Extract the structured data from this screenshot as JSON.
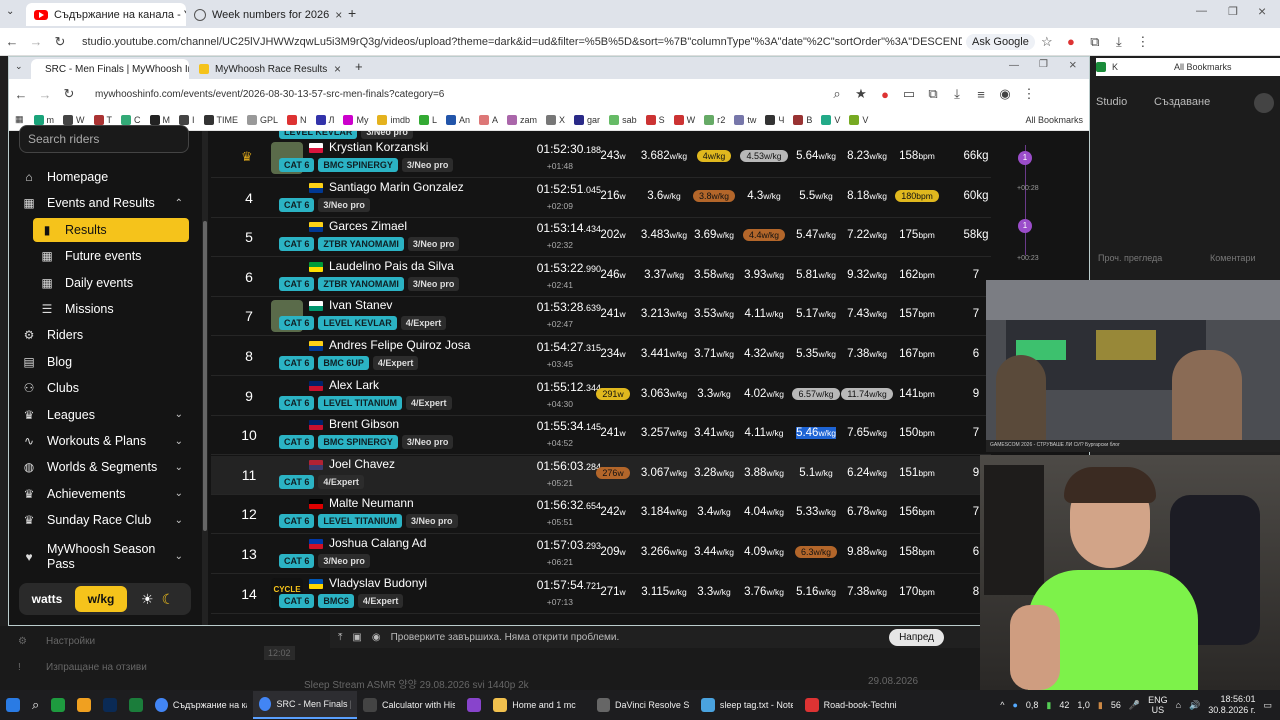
{
  "outer_browser": {
    "tabs": [
      {
        "title": "Съдържание на канала - YouT",
        "icon": "youtube-icon"
      },
      {
        "title": "Week numbers for 2026",
        "icon": "globe-icon"
      }
    ],
    "url": "studio.youtube.com/channel/UC25lVJHWWzqwLu5i3M9rQ3g/videos/upload?theme=dark&id=ud&filter=%5B%5D&sort=%7B\"columnType\"%3A\"date\"%2C\"sortOrder\"%3A\"DESCENDING\"%7D&udvid=hkzNmzPILNs",
    "ask_google": "Ask Google",
    "all_bookmarks": "All Bookmarks",
    "k_bookmark": "K"
  },
  "inner_browser": {
    "tabs": [
      {
        "title": "SRC - Men Finals | MyWhoosh In"
      },
      {
        "title": "MyWhoosh Race Results"
      }
    ],
    "url": "mywhooshinfo.com/events/event/2026-08-30-13-57-src-men-finals?category=6",
    "bookmarks": [
      "m",
      "W",
      "T",
      "C",
      "M",
      "I",
      "TIME",
      "GPL",
      "N",
      "Л",
      "My",
      "imdb",
      "L",
      "An",
      "A",
      "zam",
      "X",
      "gar",
      "sab",
      "S",
      "W",
      "г2",
      "tw",
      "Ч",
      "В",
      "V",
      "V"
    ],
    "all_bookmarks": "All Bookmarks"
  },
  "sidebar": {
    "search_placeholder": "Search riders",
    "items": [
      {
        "label": "Homepage",
        "icon": "home-icon"
      },
      {
        "label": "Events and Results",
        "icon": "calendar-icon",
        "expanded": true
      },
      {
        "label": "Results",
        "icon": "bar-chart-icon",
        "active": true,
        "sub": true
      },
      {
        "label": "Future events",
        "icon": "calendar-icon",
        "sub": true
      },
      {
        "label": "Daily events",
        "icon": "calendar-icon",
        "sub": true
      },
      {
        "label": "Missions",
        "icon": "list-icon",
        "sub": true
      },
      {
        "label": "Riders",
        "icon": "bike-icon"
      },
      {
        "label": "Blog",
        "icon": "doc-icon"
      },
      {
        "label": "Clubs",
        "icon": "users-icon"
      },
      {
        "label": "Leagues",
        "icon": "trophy-icon",
        "chev": true
      },
      {
        "label": "Workouts & Plans",
        "icon": "pulse-icon",
        "chev": true
      },
      {
        "label": "Worlds & Segments",
        "icon": "globe-icon",
        "chev": true
      },
      {
        "label": "Achievements",
        "icon": "trophy-icon",
        "chev": true
      },
      {
        "label": "Sunday Race Club",
        "icon": "trophy-icon",
        "chev": true
      },
      {
        "label": "MyWhoosh Season Pass",
        "icon": "heart-icon",
        "chev": true
      }
    ],
    "unit_watts": "watts",
    "unit_wkg": "w/kg"
  },
  "partial_top_tags": {
    "team": "LEVEL KEVLAR",
    "cls": "3/Neo pro"
  },
  "results": [
    {
      "pos": "3",
      "trophy": true,
      "name": "Krystian Korzanski",
      "flag": [
        "#fff",
        "#dc143c"
      ],
      "avatar": true,
      "cat": "CAT 6",
      "team": "BMC SPINERGY",
      "cls": "3/Neo pro",
      "time": "01:52:30",
      "ms": ".188",
      "gap": "+01:48",
      "watts": "243",
      "wkg": "3.682",
      "c1": "4",
      "c2": "4.53",
      "c3": "5.64",
      "c4": "8.23",
      "hr": "158",
      "wt": "66kg",
      "p1": "gold",
      "p2": "silver"
    },
    {
      "pos": "4",
      "name": "Santiago Marin Gonzalez",
      "flag": [
        "#fcd116",
        "#003893"
      ],
      "cat": "CAT 6",
      "cls": "3/Neo pro",
      "time": "01:52:51",
      "ms": ".045",
      "gap": "+02:09",
      "watts": "216",
      "wkg": "3.6",
      "c1": "3.8",
      "c2": "4.3",
      "c3": "5.5",
      "c4": "8.18",
      "hr": "180",
      "wt": "60kg",
      "p1": "bronze",
      "phr": "gold"
    },
    {
      "pos": "5",
      "name": "Garces Zimael",
      "flag": [
        "#fcd116",
        "#003893"
      ],
      "cat": "CAT 6",
      "team": "ZTBR YANOMAMI",
      "cls": "3/Neo pro",
      "time": "01:53:14",
      "ms": ".434",
      "gap": "+02:32",
      "watts": "202",
      "wkg": "3.483",
      "c1": "3.69",
      "c2": "4.4",
      "c3": "5.47",
      "c4": "7.22",
      "hr": "175",
      "wt": "58kg",
      "p2": "bronze"
    },
    {
      "pos": "6",
      "name": "Laudelino Pais da Silva",
      "flag": [
        "#009b3a",
        "#fedf00"
      ],
      "cat": "CAT 6",
      "team": "ZTBR YANOMAMI",
      "cls": "3/Neo pro",
      "time": "01:53:22",
      "ms": ".990",
      "gap": "+02:41",
      "watts": "246",
      "wkg": "3.37",
      "c1": "3.58",
      "c2": "3.93",
      "c3": "5.81",
      "c4": "9.32",
      "hr": "162",
      "wt": "7"
    },
    {
      "pos": "7",
      "name": "Ivan Stanev",
      "flag": [
        "#fff",
        "#00966e"
      ],
      "avatar": true,
      "cat": "CAT 6",
      "team": "LEVEL KEVLAR",
      "cls": "4/Expert",
      "time": "01:53:28",
      "ms": ".639",
      "gap": "+02:47",
      "watts": "241",
      "wkg": "3.213",
      "c1": "3.53",
      "c2": "4.11",
      "c3": "5.17",
      "c4": "7.43",
      "hr": "157",
      "wt": "7"
    },
    {
      "pos": "8",
      "name": "Andres Felipe Quiroz Josa",
      "flag": [
        "#fcd116",
        "#003893"
      ],
      "cat": "CAT 6",
      "team": "BMC 6UP",
      "cls": "4/Expert",
      "time": "01:54:27",
      "ms": ".315",
      "gap": "+03:45",
      "watts": "234",
      "wkg": "3.441",
      "c1": "3.71",
      "c2": "4.32",
      "c3": "5.35",
      "c4": "7.38",
      "hr": "167",
      "wt": "6"
    },
    {
      "pos": "9",
      "name": "Alex Lark",
      "flag": [
        "#012169",
        "#c8102e"
      ],
      "cat": "CAT 6",
      "team": "LEVEL TITANIUM",
      "cls": "4/Expert",
      "time": "01:55:12",
      "ms": ".344",
      "gap": "+04:30",
      "watts": "291",
      "wkg": "3.063",
      "c1": "3.3",
      "c2": "4.02",
      "c3": "6.57",
      "c4": "11.74",
      "hr": "141",
      "wt": "9",
      "pw": "gold",
      "p3": "silver",
      "p4": "silver"
    },
    {
      "pos": "10",
      "name": "Brent Gibson",
      "flag": [
        "#012169",
        "#c8102e"
      ],
      "cat": "CAT 6",
      "team": "BMC SPINERGY",
      "cls": "3/Neo pro",
      "time": "01:55:34",
      "ms": ".145",
      "gap": "+04:52",
      "watts": "241",
      "wkg": "3.257",
      "c1": "3.41",
      "c2": "4.11",
      "c3": "5.46",
      "c4": "7.65",
      "hr": "150",
      "wt": "7",
      "sel": true
    },
    {
      "pos": "11",
      "name": "Joel Chavez",
      "flag": [
        "#b22234",
        "#3c3b6e"
      ],
      "cat": "CAT 6",
      "cls": "4/Expert",
      "time": "01:56:03",
      "ms": ".284",
      "gap": "+05:21",
      "watts": "276",
      "wkg": "3.067",
      "c1": "3.28",
      "c2": "3.88",
      "c3": "5.1",
      "c4": "6.24",
      "hr": "151",
      "wt": "9",
      "pw": "bronze",
      "hl": true
    },
    {
      "pos": "12",
      "name": "Malte Neumann",
      "flag": [
        "#000",
        "#dd0000"
      ],
      "cat": "CAT 6",
      "team": "LEVEL TITANIUM",
      "cls": "3/Neo pro",
      "time": "01:56:32",
      "ms": ".654",
      "gap": "+05:51",
      "watts": "242",
      "wkg": "3.184",
      "c1": "3.4",
      "c2": "4.04",
      "c3": "5.33",
      "c4": "6.78",
      "hr": "156",
      "wt": "7"
    },
    {
      "pos": "13",
      "name": "Joshua Calang Ad",
      "flag": [
        "#0038a8",
        "#ce1126"
      ],
      "cat": "CAT 6",
      "cls": "3/Neo pro",
      "time": "01:57:03",
      "ms": ".293",
      "gap": "+06:21",
      "watts": "209",
      "wkg": "3.266",
      "c1": "3.44",
      "c2": "4.09",
      "c3": "6.3",
      "c4": "9.88",
      "hr": "158",
      "wt": "6",
      "p3": "bronze"
    },
    {
      "pos": "14",
      "name": "Vladyslav Budonyi",
      "flag": [
        "#0057b7",
        "#ffd700"
      ],
      "avatar": true,
      "avatar_text": "CYCLE DIE",
      "cat": "CAT 6",
      "team": "BMC6",
      "cls": "4/Expert",
      "time": "01:57:54",
      "ms": ".721",
      "gap": "+07:13",
      "watts": "271",
      "wkg": "3.115",
      "c1": "3.3",
      "c2": "3.76",
      "c3": "5.16",
      "c4": "7.38",
      "hr": "170",
      "wt": "8"
    }
  ],
  "units": {
    "w": "w",
    "wkg": "w/kg",
    "bpm": "bpm"
  },
  "youtube_behind": {
    "studio_label": "Studio",
    "create_label": "Създаване",
    "gap1": "+00:28",
    "gap2": "+00:23",
    "label1": "Проч. прегледа",
    "label2": "Коментари",
    "status_bar": "Проверките завършиха. Няма открити проблеми.",
    "next_btn": "Напред",
    "settings": "Настройки",
    "feedback": "Изпращане на отзиви",
    "row_title": "Sleep Stream ASMR 양양 29.08.2026 svi 1440p 2k",
    "row_time": "12:02",
    "row_date": "29.08.2026"
  },
  "overlay": {
    "stream_caption": "GAMESCOM 2026 - СТРУВАШЕ ЛИ СИ? Бургарски блог"
  },
  "taskbar": {
    "apps": [
      {
        "label": "Съдържание на кан",
        "icon": "chrome-icon",
        "color": "#4285f4"
      },
      {
        "label": "SRC - Men Finals | M",
        "icon": "chrome-icon",
        "color": "#4285f4",
        "active": true
      },
      {
        "label": "Calculator with His",
        "icon": "calc-icon",
        "color": "#444"
      },
      {
        "label": "",
        "icon": "app-icon",
        "color": "#8844cc"
      },
      {
        "label": "Home and 1 mc",
        "icon": "folder-icon",
        "color": "#f2c14e"
      },
      {
        "label": "DaVinci Resolve Stu",
        "icon": "davinci-icon",
        "color": "#666"
      },
      {
        "label": "sleep tag.txt - Note",
        "icon": "notepad-icon",
        "color": "#4aa3df"
      },
      {
        "label": "Road-book-Technic",
        "icon": "pdf-icon",
        "color": "#d33"
      }
    ],
    "tray_nums": [
      "0,8",
      "42",
      "1,0",
      "56"
    ],
    "lang": "ENG",
    "region": "US",
    "clock_time": "18:56:01",
    "clock_date": "30.8.2026 г."
  }
}
